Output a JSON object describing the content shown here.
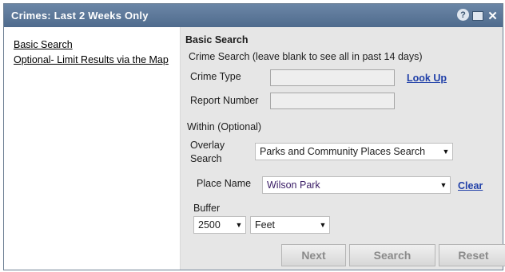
{
  "window": {
    "title": "Crimes: Last 2 Weeks Only",
    "icons": {
      "help": "?",
      "minmax": "",
      "close": "✕"
    }
  },
  "sidebar": {
    "items": [
      {
        "label": "Basic Search"
      },
      {
        "label": "Optional- Limit Results via the Map"
      }
    ]
  },
  "main": {
    "section_title": "Basic Search",
    "crime_search_hint": "Crime Search (leave blank to see all in past 14 days)",
    "crime_type_label": "Crime Type",
    "crime_type_value": "",
    "lookup_label": "Look Up",
    "report_number_label": "Report Number",
    "report_number_value": "",
    "within_label": "Within (Optional)",
    "overlay_label_line1": "Overlay",
    "overlay_label_line2": "Search",
    "overlay_value": "Parks and Community Places Search",
    "place_name_label": "Place Name",
    "place_name_value": "Wilson Park",
    "clear_label": "Clear",
    "buffer_label": "Buffer",
    "buffer_value": "2500",
    "unit_value": "Feet"
  },
  "buttons": {
    "next": "Next",
    "search": "Search",
    "reset": "Reset"
  }
}
